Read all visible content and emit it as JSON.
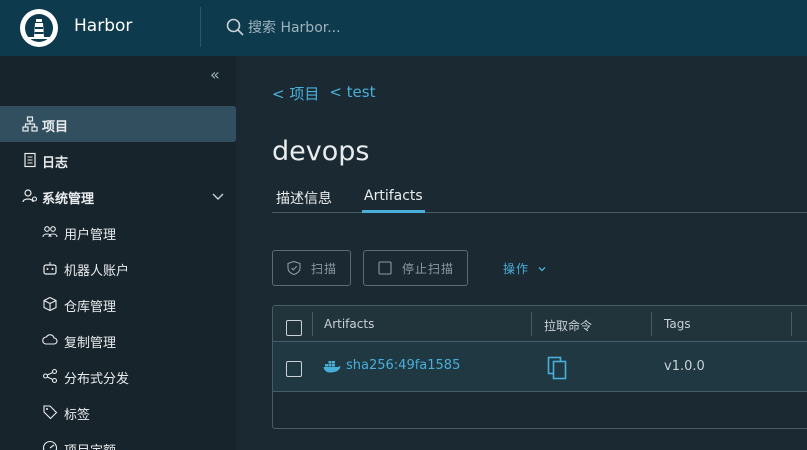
{
  "header": {
    "app_title": "Harbor",
    "search_placeholder": "搜索 Harbor..."
  },
  "sidebar": {
    "items": [
      {
        "label": "项目",
        "icon": "projects-icon",
        "active": true
      },
      {
        "label": "日志",
        "icon": "log-icon"
      },
      {
        "label": "系统管理",
        "icon": "admin-icon",
        "expanded": true
      },
      {
        "label": "用户管理",
        "icon": "users-icon"
      },
      {
        "label": "机器人账户",
        "icon": "robot-icon"
      },
      {
        "label": "仓库管理",
        "icon": "registry-icon"
      },
      {
        "label": "复制管理",
        "icon": "replication-icon"
      },
      {
        "label": "分布式分发",
        "icon": "distribution-icon"
      },
      {
        "label": "标签",
        "icon": "tag-icon"
      },
      {
        "label": "项目定额",
        "icon": "quota-icon"
      }
    ]
  },
  "breadcrumb": {
    "items": [
      "< 项目",
      "< test"
    ]
  },
  "page": {
    "title": "devops"
  },
  "tabs": {
    "items": [
      {
        "label": "描述信息"
      },
      {
        "label": "Artifacts",
        "active": true
      }
    ]
  },
  "toolbar": {
    "scan_label": "扫描",
    "stop_scan_label": "停止扫描",
    "actions_label": "操作"
  },
  "table": {
    "columns": [
      "Artifacts",
      "拉取命令",
      "Tags"
    ],
    "rows": [
      {
        "artifact": "sha256:49fa1585",
        "tags": "v1.0.0"
      }
    ]
  },
  "colors": {
    "header_bg": "#0d3a4d",
    "sidebar_bg": "#17242b",
    "active_item_bg": "#324f5f",
    "accent": "#49afd9"
  }
}
